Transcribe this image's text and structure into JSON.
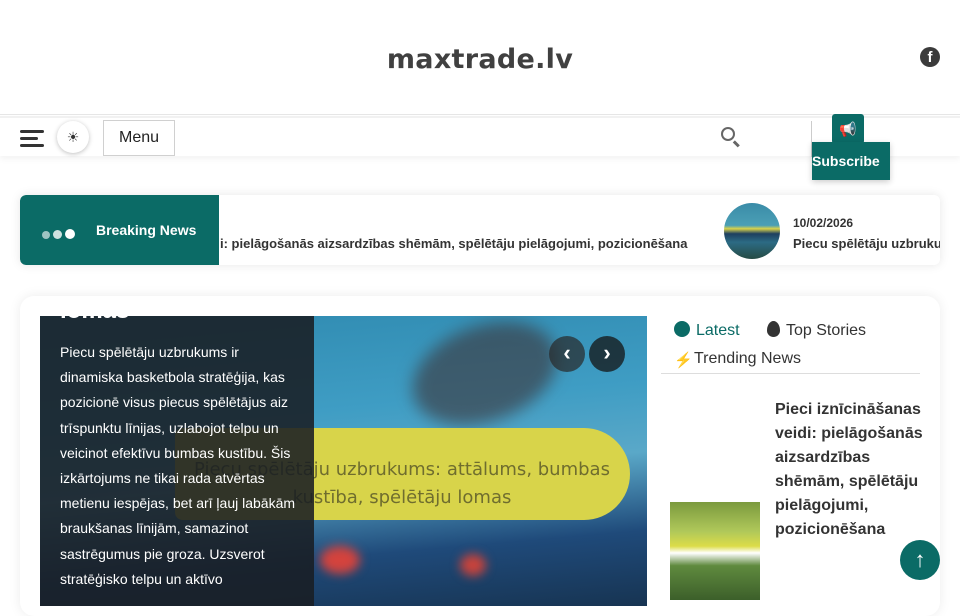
{
  "site": {
    "title": "maxtrade.lv"
  },
  "header": {
    "facebook_icon": "facebook-icon"
  },
  "nav": {
    "menu_label": "Menu",
    "subscribe_label": "Subscribe",
    "icons": [
      "hamburger-icon",
      "sun-icon",
      "search-icon",
      "megaphone-icon"
    ]
  },
  "ticker": {
    "label": "Breaking News",
    "items": [
      {
        "text": "i: pielāgošanās aizsardzības shēmām, spēlētāju pielāgojumi, pozicionēšana"
      },
      {
        "date": "10/02/2026",
        "text": "Piecu spēlētāju uzbrukums: attālums, bumbas kustība, spēlētāju lomas"
      }
    ]
  },
  "slider": {
    "heading": "lomas",
    "description": "Piecu spēlētāju uzbrukums ir dinamiska basketbola stratēģija, kas pozicionē visus piecus spēlētājus aiz trīspunktu līnijas, uzlabojot telpu un veicinot efektīvu bumbas kustību. Šis izkārtojums ne tikai rada atvērtas metienu iespējas, bet arī ļauj labākām braukšanas līnijām, samazinot sastrēgumus pie groza. Uzsverot stratēģisko telpu un aktīvo",
    "image_caption": "Piecu spēlētāju uzbrukums: attālums, bumbas kustība, spēlētāju lomas",
    "prev_icon": "chevron-left-icon",
    "next_icon": "chevron-right-icon"
  },
  "sidebar": {
    "tabs": [
      {
        "label": "Latest",
        "icon": "clock-icon",
        "active": true
      },
      {
        "label": "Top Stories",
        "icon": "fire-icon",
        "active": false
      },
      {
        "label": "Trending News",
        "icon": "bolt-icon",
        "active": false
      }
    ],
    "items": [
      {
        "title": "Pieci iznīcināšanas veidi: pielāgošanās aizsardzības shēmām, spēlētāju pielāgojumi, pozicionēšana"
      }
    ]
  },
  "scroll_top_icon": "arrow-up-icon",
  "colors": {
    "accent": "#0b6b66"
  }
}
